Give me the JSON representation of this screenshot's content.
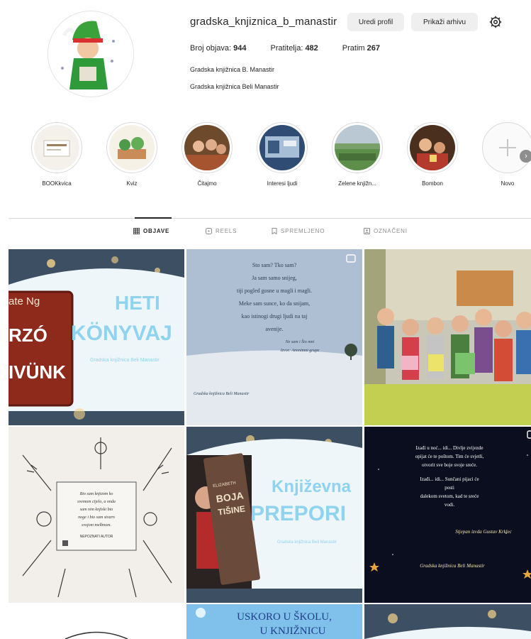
{
  "profile": {
    "username": "gradska_knjiznica_b_manastir",
    "edit_profile_label": "Uredi profil",
    "archive_label": "Prikaži arhivu",
    "stats": [
      {
        "label": "Broj objava:",
        "value": "944"
      },
      {
        "label": "Pratitelja:",
        "value": "482"
      },
      {
        "label": "Pratim",
        "value": "267"
      }
    ],
    "bio_name": "Gradska knjižnica B. Manastir",
    "bio_text": "Gradska knjižnica Beli Manastir"
  },
  "highlights": [
    {
      "label": "BOOKkvica"
    },
    {
      "label": "Kviz"
    },
    {
      "label": "Čitajmo"
    },
    {
      "label": "Interesi ljudi"
    },
    {
      "label": "Zelene knjižn..."
    },
    {
      "label": "Bombon"
    },
    {
      "label": "Novo"
    }
  ],
  "tabs": [
    {
      "label": "OBJAVE"
    },
    {
      "label": "REELS"
    },
    {
      "label": "SPREMLJENO"
    },
    {
      "label": "OZNAČENI"
    }
  ],
  "posts": {
    "p1": {
      "line1": "HETI",
      "line2": "KÖNYVAJ",
      "book_top": "ate Ng",
      "book_mid": "RZÓ",
      "book_bot": "IVÜNK",
      "footer": "Gradska knjižnica Beli Manastir"
    },
    "p2": {
      "lines": [
        "Sto sam? Tko sam?",
        "Ja sam samo snijeg,",
        "tiji pogled gosne u magli i magli.",
        "Meke sam sunce, ko da snijam,",
        "kao istinogi drugi ljudi na taj",
        "avenije."
      ],
      "sign1": "Ne sam i Što mni",
      "sign2": "Izvor: Anonimni grupe",
      "footer": "Gradska knjižnica Beli Manastir"
    },
    "p4": {
      "lines": [
        "Bio sam knjizom ko",
        "svemom cijelo, a onda",
        "sam nim knjiski bio",
        "noge i bio sam stvarn",
        "svojom melbnom."
      ],
      "author": "NEPOZNATI AUTOR"
    },
    "p5": {
      "line1": "Književna",
      "line2": "PREPORI",
      "book_a": "ELIZABETH",
      "book_b": "BOJA",
      "book_c": "TIŠINE",
      "footer": "Gradska knjižnica Beli Manastir"
    },
    "p6": {
      "lines": [
        "Izađi u noć... idi... Divlje zvijezde",
        "opijat će te poštom. Tim će svjetli,",
        "otvorit sve boje svoje sreće.",
        "Izađi... idi... Sunčani pijaci će",
        "posti",
        "dalekom svetom, kad te sreće",
        "vodi."
      ],
      "sign": "Stjepan izvda Gustav Krklec",
      "footer": "Gradska knjižnica Beli Manastir"
    },
    "p8": {
      "line1": "USKORO U ŠKOLU,",
      "line2": "U KNJIŽNICU"
    }
  },
  "colors": {
    "text": "#262626",
    "muted": "#8e8e8e",
    "button_bg": "#efefef",
    "border": "#dbdbdb",
    "accent_blue": "#8fd3ee"
  }
}
